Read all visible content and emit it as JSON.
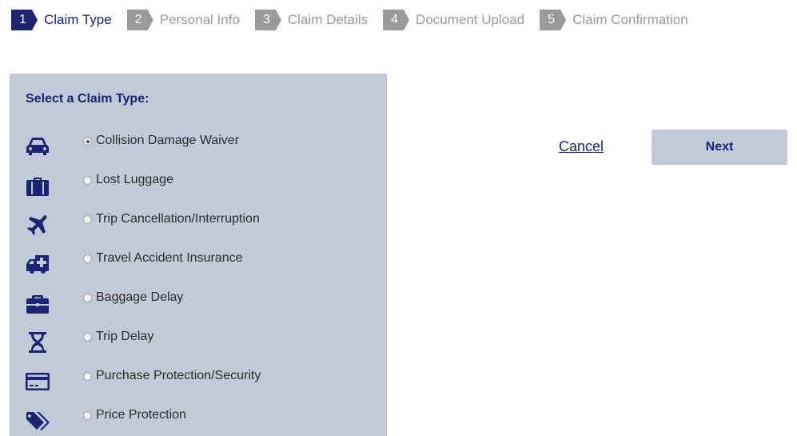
{
  "stepper": {
    "steps": [
      {
        "number": "1",
        "label": "Claim Type"
      },
      {
        "number": "2",
        "label": "Personal Info"
      },
      {
        "number": "3",
        "label": "Claim Details"
      },
      {
        "number": "4",
        "label": "Document Upload"
      },
      {
        "number": "5",
        "label": "Claim Confirmation"
      }
    ],
    "active_step": 1
  },
  "claim_panel": {
    "title": "Select a Claim Type:",
    "options": [
      {
        "label": "Collision Damage Waiver",
        "icon": "car-icon",
        "checked": true
      },
      {
        "label": "Lost Luggage",
        "icon": "luggage-icon",
        "checked": false
      },
      {
        "label": "Trip Cancellation/Interruption",
        "icon": "airplane-icon",
        "checked": false
      },
      {
        "label": "Travel Accident Insurance",
        "icon": "ambulance-icon",
        "checked": false
      },
      {
        "label": "Baggage Delay",
        "icon": "briefcase-icon",
        "checked": false
      },
      {
        "label": "Trip Delay",
        "icon": "hourglass-icon",
        "checked": false
      },
      {
        "label": "Purchase Protection/Security",
        "icon": "credit-card-icon",
        "checked": false
      },
      {
        "label": "Price Protection",
        "icon": "price-tags-icon",
        "checked": false
      }
    ]
  },
  "actions": {
    "cancel_label": "Cancel",
    "next_label": "Next"
  },
  "colors": {
    "brand_navy": "#1b2470",
    "inactive_gray": "#9a9a9a",
    "panel_background": "#c1cad9"
  }
}
